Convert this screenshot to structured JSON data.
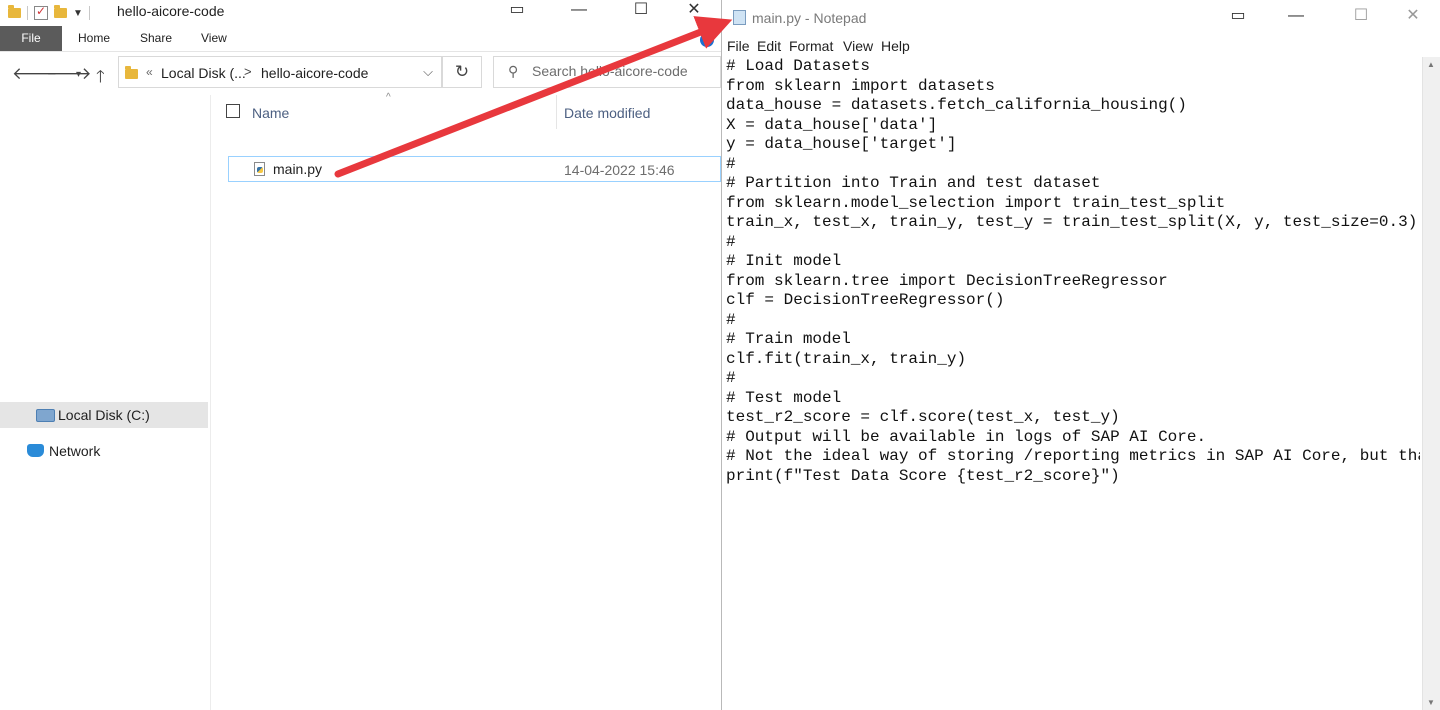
{
  "explorer": {
    "title": "hello-aicore-code",
    "ribbon_tabs": [
      "File",
      "Home",
      "Share",
      "View"
    ],
    "address": {
      "prefix": "«",
      "parent": "Local Disk (...",
      "separator": ">",
      "current": "hello-aicore-code"
    },
    "search_placeholder": "Search hello-aicore-code",
    "columns": {
      "name": "Name",
      "date_modified": "Date modified"
    },
    "files": [
      {
        "name": "main.py",
        "date_modified": "14-04-2022 15:46"
      }
    ],
    "nav_pane": [
      {
        "label": "Local Disk (C:)",
        "selected": true,
        "icon": "drive-icon"
      },
      {
        "label": "Network",
        "selected": false,
        "icon": "network-icon"
      }
    ]
  },
  "notepad": {
    "title": "main.py - Notepad",
    "menu": [
      "File",
      "Edit",
      "Format",
      "View",
      "Help"
    ],
    "lines": [
      "# Load Datasets",
      "from sklearn import datasets",
      "data_house = datasets.fetch_california_housing()",
      "X = data_house['data']",
      "y = data_house['target']",
      "#",
      "# Partition into Train and test dataset",
      "from sklearn.model_selection import train_test_split",
      "train_x, test_x, train_y, test_y = train_test_split(X, y, test_size=0.3)",
      "#",
      "# Init model",
      "from sklearn.tree import DecisionTreeRegressor",
      "clf = DecisionTreeRegressor()",
      "#",
      "# Train model",
      "clf.fit(train_x, train_y)",
      "#",
      "# Test model",
      "test_r2_score = clf.score(test_x, test_y)",
      "# Output will be available in logs of SAP AI Core.",
      "# Not the ideal way of storing /reporting metrics in SAP AI Core, but that is",
      "print(f\"Test Data Score {test_r2_score}\")"
    ]
  },
  "annotation": {
    "arrow_color": "#e8383d"
  }
}
